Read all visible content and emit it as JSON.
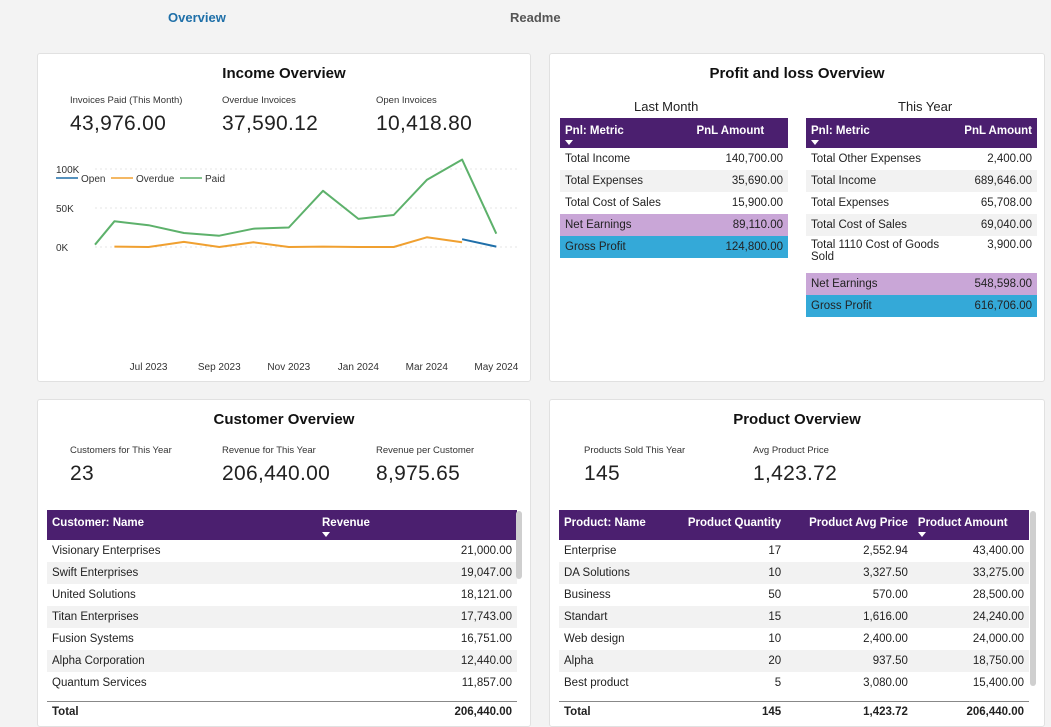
{
  "tabs": {
    "overview": "Overview",
    "readme": "Readme"
  },
  "income": {
    "title": "Income Overview",
    "kpis": [
      {
        "label": "Invoices Paid (This Month)",
        "value": "43,976.00"
      },
      {
        "label": "Overdue Invoices",
        "value": "37,590.12"
      },
      {
        "label": "Open Invoices",
        "value": "10,418.80"
      }
    ],
    "legend": {
      "open": "Open",
      "overdue": "Overdue",
      "paid": "Paid"
    }
  },
  "chart_data": {
    "type": "line",
    "title": "",
    "xlabel": "",
    "ylabel": "",
    "x": [
      "2023-06",
      "2023-07",
      "2023-08",
      "2023-09",
      "2023-10",
      "2023-11",
      "2023-12",
      "2024-01",
      "2024-02",
      "2024-03",
      "2024-04",
      "2024-05"
    ],
    "x_tick_labels": [
      "Jul 2023",
      "Sep 2023",
      "Nov 2023",
      "Jan 2024",
      "Mar 2024",
      "May 2024"
    ],
    "y_tick_labels": [
      "0K",
      "50K",
      "100K"
    ],
    "ylim": [
      0,
      115000
    ],
    "colors": {
      "open": "#1f6fa9",
      "overdue": "#f0a030",
      "paid": "#5db16b"
    },
    "series": [
      {
        "name": "Paid",
        "values": [
          3000,
          33000,
          28000,
          18000,
          14500,
          23500,
          25000,
          72000,
          36000,
          41000,
          86000,
          112000,
          17000
        ],
        "x_points": [
          "2023-05-15",
          "2023-06-01",
          "2023-07-01",
          "2023-08-01",
          "2023-09-01",
          "2023-10-01",
          "2023-11-01",
          "2023-12-01",
          "2024-01-01",
          "2024-02-01",
          "2024-03-01",
          "2024-04-01",
          "2024-05-01"
        ]
      },
      {
        "name": "Overdue",
        "values": [
          500,
          0,
          6500,
          0,
          6000,
          0,
          500,
          0,
          0,
          12500,
          6000
        ],
        "x_points": [
          "2023-06-01",
          "2023-07-01",
          "2023-08-01",
          "2023-09-01",
          "2023-10-01",
          "2023-11-01",
          "2023-12-01",
          "2024-01-01",
          "2024-02-01",
          "2024-03-01",
          "2024-04-01"
        ]
      },
      {
        "name": "Open",
        "values": [
          10000,
          500
        ],
        "x_points": [
          "2024-04-01",
          "2024-05-01"
        ]
      }
    ],
    "grid": true,
    "legend_position": "top-left"
  },
  "pnl": {
    "title": "Profit and loss Overview",
    "last_month": {
      "title": "Last Month",
      "headers": [
        "Pnl: Metric",
        "PnL Amount"
      ],
      "rows": [
        [
          "Total Income",
          "140,700.00"
        ],
        [
          "Total Expenses",
          "35,690.00"
        ],
        [
          "Total Cost of Sales",
          "15,900.00"
        ],
        [
          "Net Earnings",
          "89,110.00"
        ],
        [
          "Gross Profit",
          "124,800.00"
        ]
      ]
    },
    "this_year": {
      "title": "This Year",
      "headers": [
        "Pnl: Metric",
        "PnL Amount"
      ],
      "rows": [
        [
          "Total Other Expenses",
          "2,400.00"
        ],
        [
          "Total Income",
          "689,646.00"
        ],
        [
          "Total Expenses",
          "65,708.00"
        ],
        [
          "Total Cost of Sales",
          "69,040.00"
        ],
        [
          "Total 1110 Cost of Goods Sold",
          "3,900.00"
        ],
        [
          "Net Earnings",
          "548,598.00"
        ],
        [
          "Gross Profit",
          "616,706.00"
        ]
      ]
    },
    "colors": {
      "net_earnings": "#c9a6d7",
      "gross_profit": "#34a9d8",
      "header": "#4b1f6f"
    }
  },
  "customer": {
    "title": "Customer Overview",
    "kpis": [
      {
        "label": "Customers for This Year",
        "value": "23"
      },
      {
        "label": "Revenue for This Year",
        "value": "206,440.00"
      },
      {
        "label": "Revenue per Customer",
        "value": "8,975.65"
      }
    ],
    "headers": [
      "Customer: Name",
      "Revenue"
    ],
    "rows": [
      [
        "Visionary Enterprises",
        "21,000.00"
      ],
      [
        "Swift Enterprises",
        "19,047.00"
      ],
      [
        "United Solutions",
        "18,121.00"
      ],
      [
        "Titan Enterprises",
        "17,743.00"
      ],
      [
        "Fusion Systems",
        "16,751.00"
      ],
      [
        "Alpha Corporation",
        "12,440.00"
      ],
      [
        "Quantum Services",
        "11,857.00"
      ]
    ],
    "total": [
      "Total",
      "206,440.00"
    ]
  },
  "product": {
    "title": "Product Overview",
    "kpis": [
      {
        "label": "Products Sold This Year",
        "value": "145"
      },
      {
        "label": "Avg Product Price",
        "value": "1,423.72"
      }
    ],
    "headers": [
      "Product: Name",
      "Product Quantity",
      "Product Avg Price",
      "Product Amount"
    ],
    "rows": [
      [
        "Enterprise",
        "17",
        "2,552.94",
        "43,400.00"
      ],
      [
        "DA Solutions",
        "10",
        "3,327.50",
        "33,275.00"
      ],
      [
        "Business",
        "50",
        "570.00",
        "28,500.00"
      ],
      [
        "Standart",
        "15",
        "1,616.00",
        "24,240.00"
      ],
      [
        "Web design",
        "10",
        "2,400.00",
        "24,000.00"
      ],
      [
        "Alpha",
        "20",
        "937.50",
        "18,750.00"
      ],
      [
        "Best product",
        "5",
        "3,080.00",
        "15,400.00"
      ]
    ],
    "total": [
      "Total",
      "145",
      "1,423.72",
      "206,440.00"
    ]
  }
}
